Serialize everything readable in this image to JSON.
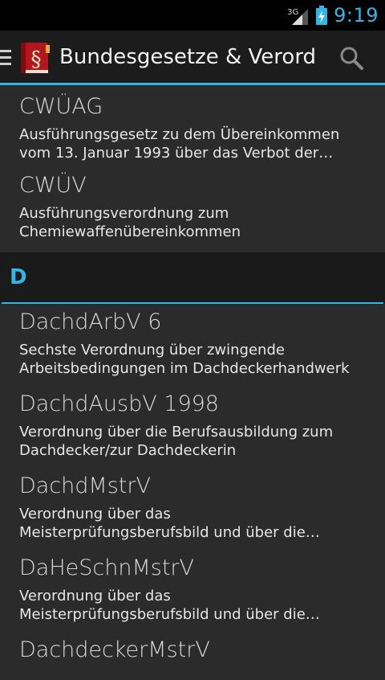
{
  "status": {
    "network": "3G",
    "time": "9:19"
  },
  "actionbar": {
    "title": "Bundesgesetze & Verord…",
    "icons": [
      "menu-icon",
      "law-book-icon",
      "search-icon"
    ]
  },
  "colors": {
    "accent": "#33b5e5",
    "background": "#2b2b2b",
    "header": "#1c1c1c"
  },
  "list": {
    "items_before": [
      {
        "title": "CWÜAG",
        "desc1": "Ausführungsgesetz zu dem Übereinkommen",
        "desc2": "vom 13. Januar 1993 über das Verbot der…"
      },
      {
        "title": "CWÜV",
        "desc1": "Ausführungsverordnung zum",
        "desc2": "Chemiewaffenübereinkommen"
      }
    ],
    "section": "D",
    "items_after": [
      {
        "title": "DachdArbV 6",
        "desc1": "Sechste Verordnung über zwingende",
        "desc2": "Arbeitsbedingungen im Dachdeckerhandwerk"
      },
      {
        "title": "DachdAusbV 1998",
        "desc1": "Verordnung über die Berufsausbildung zum",
        "desc2": "Dachdecker/zur Dachdeckerin"
      },
      {
        "title": "DachdMstrV",
        "desc1": "Verordnung über das",
        "desc2": "Meisterprüfungsberufsbild und über die…"
      },
      {
        "title": "DaHeSchnMstrV",
        "desc1": "Verordnung über das",
        "desc2": "Meisterprüfungsberufsbild und über die…"
      },
      {
        "title": "DachdeckerMstrV",
        "desc1": "",
        "desc2": ""
      }
    ]
  }
}
